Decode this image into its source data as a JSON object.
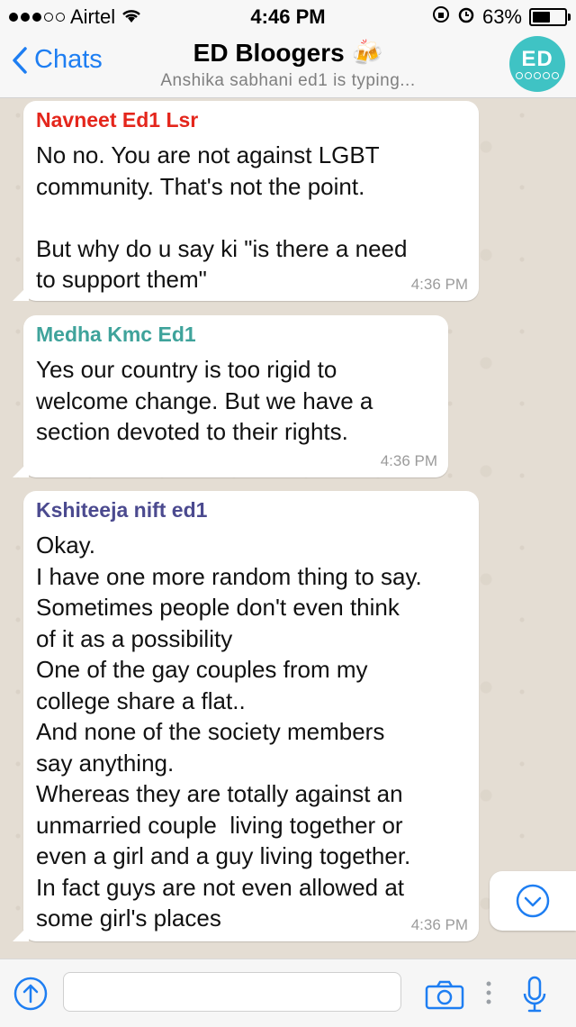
{
  "status_bar": {
    "carrier": "Airtel",
    "time": "4:46 PM",
    "battery": "63%",
    "battery_level": 0.63
  },
  "header": {
    "back_label": "Chats",
    "title": "ED Bloogers 🍻",
    "subtitle": "Anshika sabhani ed1 is typing...",
    "avatar_text": "ED"
  },
  "messages": [
    {
      "sender": "Navneet Ed1 Lsr",
      "sender_color": "#e4261c",
      "text": "No no. You are not against LGBT\ncommunity. That's not the point.\n\nBut why do u say ki \"is there a need\nto support them\"",
      "time": "4:36 PM"
    },
    {
      "sender": "Medha Kmc Ed1",
      "sender_color": "#3fa39b",
      "text": "Yes our country is too rigid to\nwelcome change. But we have a\nsection devoted to their rights.",
      "time": "4:36 PM"
    },
    {
      "sender": "Kshiteeja nift ed1",
      "sender_color": "#4b4a8f",
      "text": "Okay.\nI have one more random thing to say.\nSometimes people don't even think\nof it as a possibility\nOne of the gay couples from my\ncollege share a flat..\nAnd none of the society members\nsay anything.\nWhereas they are totally against an\nunmarried couple  living together or\neven a girl and a guy living together.\nIn fact guys are not even allowed at\nsome girl's places",
      "time": "4:36 PM"
    }
  ],
  "input": {
    "placeholder": ""
  },
  "colors": {
    "accent": "#1e7ef2",
    "wallpaper": "#e4ddd3"
  }
}
